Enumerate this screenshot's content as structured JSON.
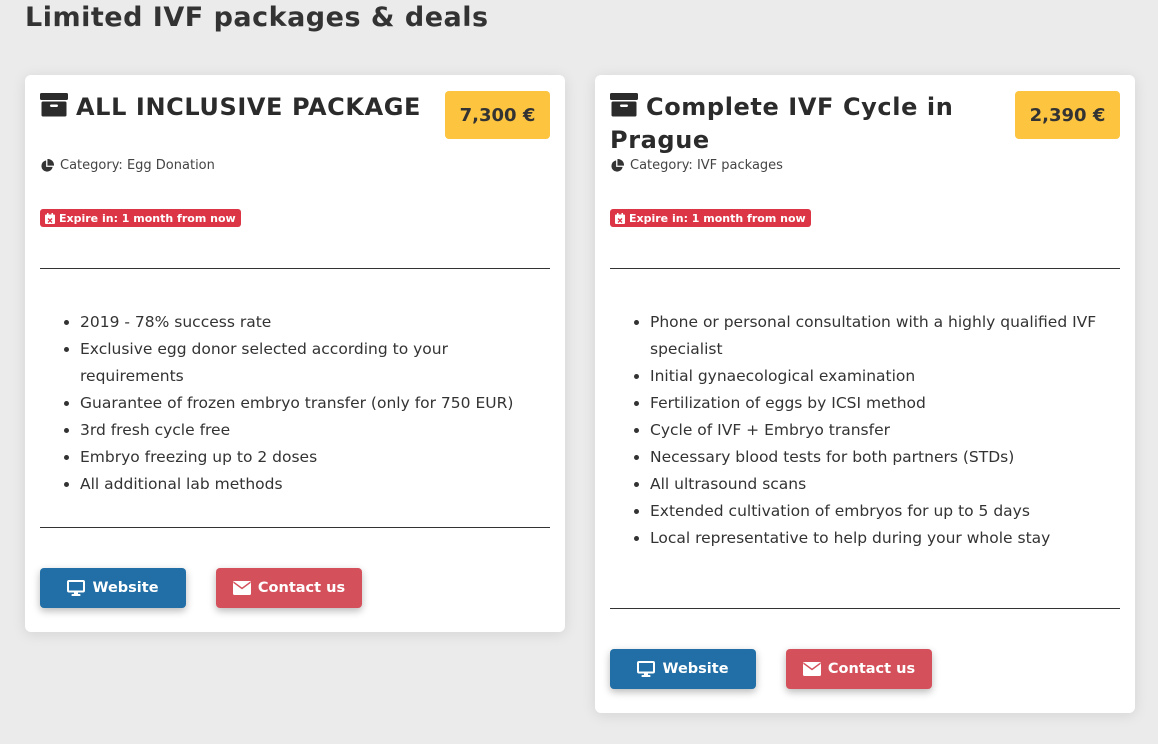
{
  "page": {
    "title": "Limited IVF packages & deals"
  },
  "colors": {
    "background": "#ebebeb",
    "price_badge": "#fcc43f",
    "expire_badge": "#dc3545",
    "website_button": "#216fa6",
    "contact_button": "#d4515c"
  },
  "cards": [
    {
      "icon": "archive-box-icon",
      "title": "ALL INCLUSIVE PACKAGE",
      "price": "7,300 €",
      "category_icon": "pie-chart-icon",
      "category": "Category: Egg Donation",
      "expire_icon": "calendar-x-icon",
      "expire": "Expire in: 1 month from now",
      "features": [
        "2019 - 78% success rate",
        "Exclusive egg donor selected according to your requirements",
        "Guarantee of frozen embryo transfer (only for 750 EUR)",
        "3rd fresh cycle free",
        "Embryo freezing up to 2 doses",
        "All additional lab methods"
      ],
      "website_icon": "monitor-icon",
      "website_label": "Website",
      "contact_icon": "envelope-icon",
      "contact_label": "Contact us"
    },
    {
      "icon": "archive-box-icon",
      "title": "Complete IVF Cycle in Prague",
      "price": "2,390 €",
      "category_icon": "pie-chart-icon",
      "category": "Category: IVF packages",
      "expire_icon": "calendar-x-icon",
      "expire": "Expire in: 1 month from now",
      "features": [
        "Phone or personal consultation with a highly qualified IVF specialist",
        "Initial gynaecological examination",
        "Fertilization of eggs by ICSI method",
        "Cycle of IVF + Embryo transfer",
        "Necessary blood tests for both partners (STDs)",
        "All ultrasound scans",
        "Extended cultivation of embryos for up to 5 days",
        "Local representative to help during your whole stay"
      ],
      "website_icon": "monitor-icon",
      "website_label": "Website",
      "contact_icon": "envelope-icon",
      "contact_label": "Contact us"
    }
  ]
}
